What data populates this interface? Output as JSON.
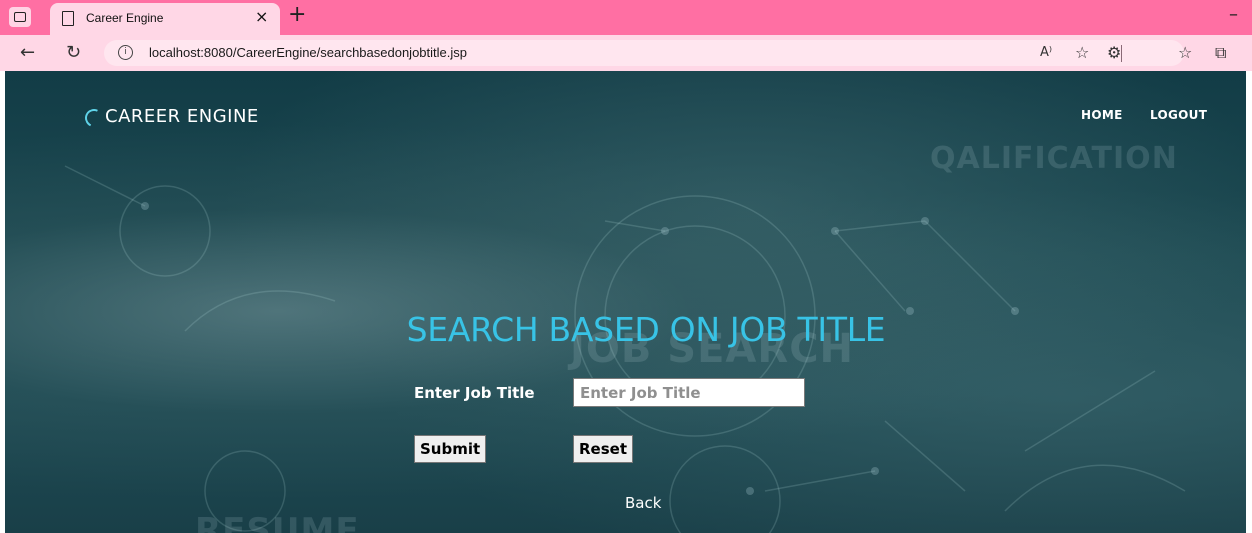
{
  "browser": {
    "tab_title": "Career Engine",
    "tab_close": "×",
    "new_tab": "+",
    "minimize": "–",
    "url": "localhost:8080/CareerEngine/searchbasedonjobtitle.jsp"
  },
  "site": {
    "logo": "CAREER ENGINE",
    "nav": {
      "home": "HOME",
      "logout": "LOGOUT"
    }
  },
  "background_words": [
    "QALIFICATION",
    "JOB SEARCH",
    "RESUME"
  ],
  "form": {
    "heading": "SEARCH BASED ON JOB TITLE",
    "label": "Enter Job Title",
    "placeholder": "Enter Job Title",
    "value": "",
    "submit": "Submit",
    "reset": "Reset",
    "back": "Back"
  },
  "colors": {
    "tab_strip": "#ff6fa3",
    "heading": "#38c3e6",
    "page_bg": "#1d4a52"
  }
}
